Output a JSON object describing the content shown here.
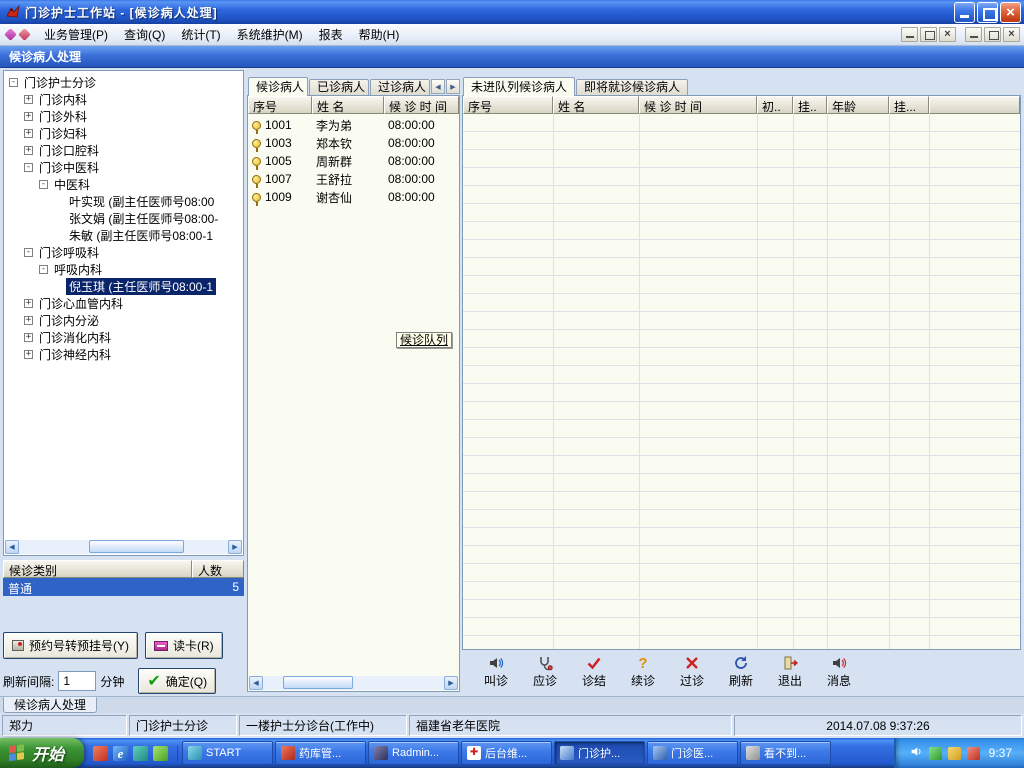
{
  "colors": {
    "titlebar_blue": "#2E67DD",
    "selection_navy": "#0A246A",
    "row_selection_blue": "#2F63C6",
    "taskbar_blue": "#2E66D6",
    "start_green": "#3C9434",
    "panel_bg": "#FBFCF1"
  },
  "titlebar": {
    "title": "门诊护士工作站 - [候诊病人处理]"
  },
  "menubar": {
    "items": [
      "业务管理(P)",
      "查询(Q)",
      "统计(T)",
      "系统维护(M)",
      "报表",
      "帮助(H)"
    ]
  },
  "subheader": {
    "title": "候诊病人处理"
  },
  "tree": {
    "items": [
      {
        "label": "门诊护士分诊",
        "level": 0,
        "expander": "-"
      },
      {
        "label": "门诊内科",
        "level": 1,
        "expander": "+"
      },
      {
        "label": "门诊外科",
        "level": 1,
        "expander": "+"
      },
      {
        "label": "门诊妇科",
        "level": 1,
        "expander": "+"
      },
      {
        "label": "门诊口腔科",
        "level": 1,
        "expander": "+"
      },
      {
        "label": "门诊中医科",
        "level": 1,
        "expander": "-"
      },
      {
        "label": "中医科",
        "level": 2,
        "expander": "-"
      },
      {
        "label": "叶实现 (副主任医师号08:00",
        "level": 3,
        "expander": "none"
      },
      {
        "label": "张文娟 (副主任医师号08:00-",
        "level": 3,
        "expander": "none"
      },
      {
        "label": "朱敏 (副主任医师号08:00-1",
        "level": 3,
        "expander": "none"
      },
      {
        "label": "门诊呼吸科",
        "level": 1,
        "expander": "-"
      },
      {
        "label": "呼吸内科",
        "level": 2,
        "expander": "-"
      },
      {
        "label": "倪玉琪 (主任医师号08:00-1",
        "level": 3,
        "expander": "none",
        "selected": true
      },
      {
        "label": "门诊心血管内科",
        "level": 1,
        "expander": "+"
      },
      {
        "label": "门诊内分泌",
        "level": 1,
        "expander": "+"
      },
      {
        "label": "门诊消化内科",
        "level": 1,
        "expander": "+"
      },
      {
        "label": "门诊神经内科",
        "level": 1,
        "expander": "+"
      }
    ]
  },
  "class_table": {
    "headers": [
      "候诊类别",
      "人数"
    ],
    "row": [
      "普通",
      "5"
    ]
  },
  "left_buttons": {
    "reserve_transfer": "预约号转预挂号(Y)",
    "read_card": "读卡(R)"
  },
  "refresh_row": {
    "label": "刷新间隔:",
    "value": "1",
    "unit": "分钟",
    "confirm": "确定(Q)"
  },
  "middle": {
    "tabs": [
      {
        "label": "候诊病人",
        "active": true
      },
      {
        "label": "已诊病人"
      },
      {
        "label": "过诊病人"
      }
    ],
    "headers": [
      "序号",
      "姓 名",
      "候 诊 时 间"
    ],
    "rows": [
      [
        "1001",
        "李为弟",
        "08:00:00"
      ],
      [
        "1003",
        "郑本钦",
        "08:00:00"
      ],
      [
        "1005",
        "周新群",
        "08:00:00"
      ],
      [
        "1007",
        "王舒拉",
        "08:00:00"
      ],
      [
        "1009",
        "谢杏仙",
        "08:00:00"
      ]
    ],
    "tooltip": "候诊队列"
  },
  "right": {
    "tabs": [
      {
        "label": "未进队列候诊病人",
        "active": true
      },
      {
        "label": "即将就诊候诊病人"
      }
    ],
    "headers": [
      "序号",
      "姓 名",
      "候 诊 时 间",
      "初..",
      "挂..",
      "年龄",
      "挂..."
    ]
  },
  "toolbar": {
    "buttons": [
      {
        "label": "叫诊",
        "icon": "speaker-icon"
      },
      {
        "label": "应诊",
        "icon": "stethoscope-icon"
      },
      {
        "label": "诊结",
        "icon": "red-check-icon"
      },
      {
        "label": "续诊",
        "icon": "question-icon"
      },
      {
        "label": "过诊",
        "icon": "red-cross-icon"
      },
      {
        "label": "刷新",
        "icon": "refresh-icon"
      },
      {
        "label": "退出",
        "icon": "exit-icon"
      },
      {
        "label": "消息",
        "icon": "message-speaker-icon"
      }
    ]
  },
  "bottom_tab": {
    "label": "候诊病人处理"
  },
  "statusbar": {
    "cells": [
      "郑力",
      "门诊护士分诊",
      "一楼护士分诊台(工作中)",
      "福建省老年医院",
      "2014.07.08 9:37:26"
    ]
  },
  "taskbar": {
    "start": "开始",
    "buttons": [
      {
        "label": "START"
      },
      {
        "label": "药库管..."
      },
      {
        "label": "Radmin..."
      },
      {
        "label": "后台维..."
      },
      {
        "label": "门诊护...",
        "active": true
      },
      {
        "label": "门诊医..."
      },
      {
        "label": "看不到..."
      }
    ],
    "tray_time": "9:37"
  }
}
